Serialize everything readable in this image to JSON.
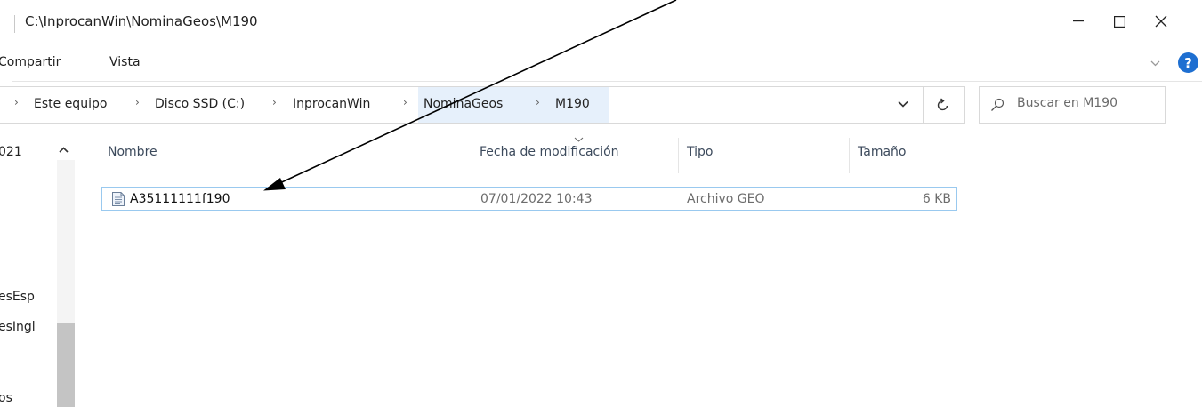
{
  "window": {
    "title": "C:\\InprocanWin\\NominaGeos\\M190",
    "minimize_glyph": "—",
    "close_glyph": "✕"
  },
  "ribbon": {
    "tabs": [
      {
        "label": "Compartir"
      },
      {
        "label": "Vista"
      }
    ],
    "help_glyph": "?"
  },
  "address_bar": {
    "breadcrumbs": [
      {
        "label": "Este equipo"
      },
      {
        "label": "Disco SSD (C:)"
      },
      {
        "label": "InprocanWin"
      },
      {
        "label": "NominaGeos"
      },
      {
        "label": "M190"
      }
    ],
    "separator": "›"
  },
  "search": {
    "placeholder": "Buscar en M190"
  },
  "nav_pane": {
    "items": [
      {
        "label": "021"
      },
      {
        "label": "esEsp"
      },
      {
        "label": "esIngl"
      },
      {
        "label": "os"
      }
    ]
  },
  "file_list": {
    "columns": [
      {
        "label": "Nombre"
      },
      {
        "label": "Fecha de modificación"
      },
      {
        "label": "Tipo"
      },
      {
        "label": "Tamaño"
      }
    ],
    "rows": [
      {
        "name": "A35111111f190",
        "date": "07/01/2022 10:43",
        "type": "Archivo GEO",
        "size": "6 KB",
        "icon": "geo-file-icon"
      }
    ]
  },
  "colors": {
    "selection_border": "#99c9ef",
    "breadcrumb_highlight": "#e6f0fb",
    "help_blue": "#1e6fd1",
    "header_text": "#3c4a5c"
  }
}
